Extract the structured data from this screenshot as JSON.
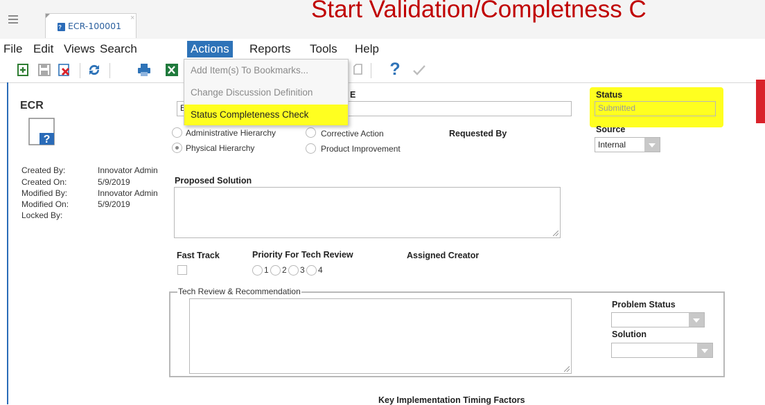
{
  "slide_title": "Start Validation/Completness C",
  "tab": {
    "label": "ECR-100001",
    "close": "×"
  },
  "menu": [
    "File",
    "Edit",
    "Views",
    "Search",
    "Actions",
    "Reports",
    "Tools",
    "Help"
  ],
  "actions_menu": {
    "items": [
      {
        "label": "Add Item(s) To Bookmarks...",
        "enabled": false
      },
      {
        "label": "Change Discussion Definition",
        "enabled": false
      },
      {
        "label": "Status Completeness Check",
        "enabled": true,
        "highlighted": true
      }
    ]
  },
  "toolbar": {
    "icons": [
      "new-icon",
      "save-icon",
      "delete-icon",
      "refresh-icon",
      "print-icon",
      "excel-icon",
      "copy-icon",
      "help-icon",
      "check-icon"
    ],
    "help_glyph": "?"
  },
  "item": {
    "type": "ECR",
    "icon_glyph": "?",
    "meta": [
      {
        "label": "Created By:",
        "value": "Innovator Admin"
      },
      {
        "label": "Created On:",
        "value": "5/9/2019"
      },
      {
        "label": "Modified By:",
        "value": "Innovator Admin"
      },
      {
        "label": "Modified On:",
        "value": "5/9/2019"
      },
      {
        "label": "Locked By:",
        "value": ""
      }
    ]
  },
  "form": {
    "ecr_label_fragment": "E",
    "ecr_value_fragment": "E",
    "hierarchy_options": [
      {
        "label": "Administrative Hierarchy",
        "checked": false
      },
      {
        "label": "Physical Hierarchy",
        "checked": true
      }
    ],
    "reason_options": [
      {
        "label": "Corrective Action",
        "checked": false
      },
      {
        "label": "Product Improvement",
        "checked": false
      }
    ],
    "requested_by_label": "Requested By",
    "status_label": "Status",
    "status_value": "Submitted",
    "source_label": "Source",
    "source_value": "Internal",
    "proposed_solution_label": "Proposed Solution",
    "fast_track_label": "Fast Track",
    "priority_label": "Priority For Tech Review",
    "priority_options": [
      "1",
      "2",
      "3",
      "4"
    ],
    "assigned_creator_label": "Assigned Creator",
    "tech_review_legend": "Tech Review & Recommendation",
    "problem_status_label": "Problem Status",
    "solution_label": "Solution",
    "timing_label": "Key Implementation Timing Factors"
  },
  "colors": {
    "accent": "#2e73b8",
    "highlight": "#ffff20",
    "title_red": "#c00000",
    "marker_red": "#d9222a"
  }
}
